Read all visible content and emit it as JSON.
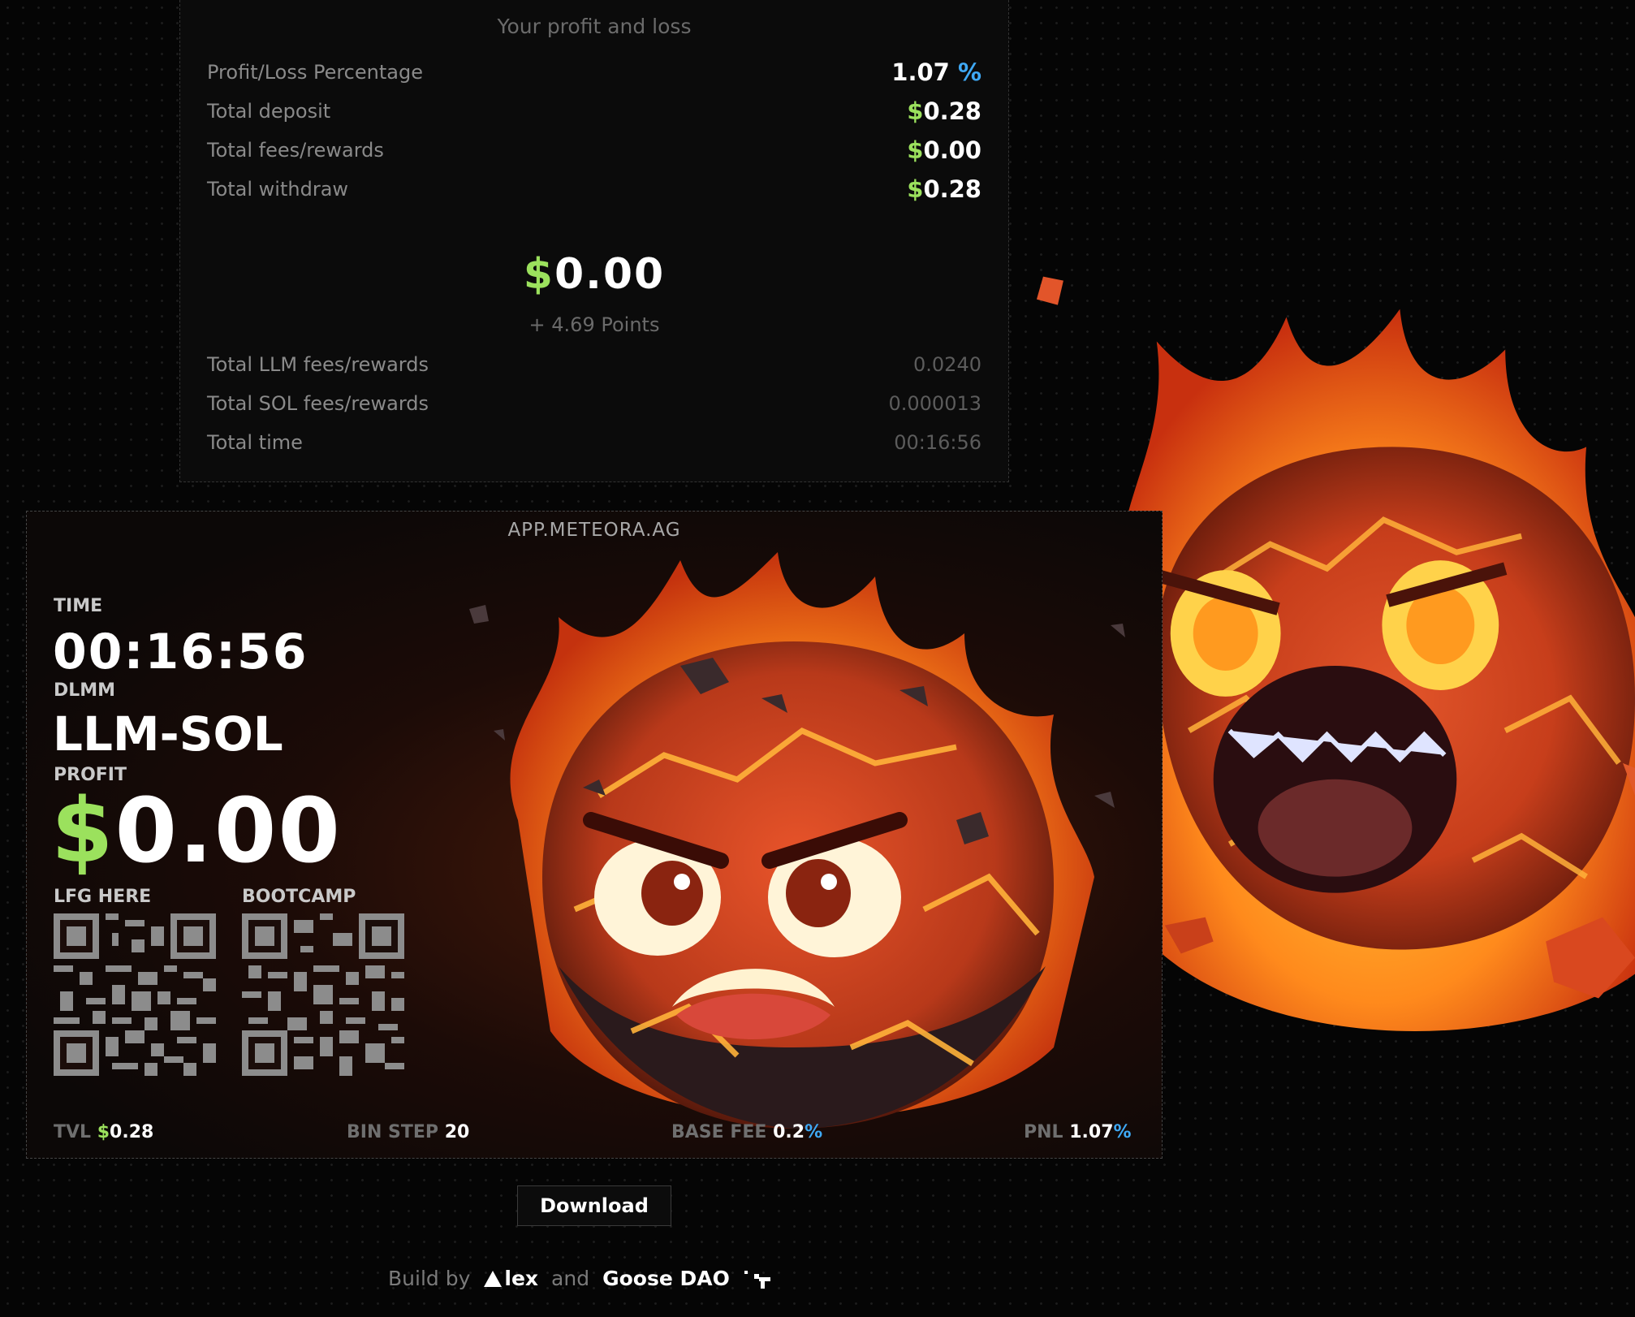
{
  "pnl": {
    "title": "Your profit and loss",
    "rows": [
      {
        "label": "Profit/Loss Percentage",
        "value": "1.07",
        "unit": "%"
      },
      {
        "label": "Total deposit",
        "currency": "$",
        "value": "0.28"
      },
      {
        "label": "Total fees/rewards",
        "currency": "$",
        "value": "0.00"
      },
      {
        "label": "Total withdraw",
        "currency": "$",
        "value": "0.28"
      }
    ],
    "profit_currency": "$",
    "profit_value": "0.00",
    "points": "+ 4.69 Points",
    "detail_rows": [
      {
        "label": "Total LLM fees/rewards",
        "value": "0.0240"
      },
      {
        "label": "Total SOL fees/rewards",
        "value": "0.000013"
      },
      {
        "label": "Total time",
        "value": "00:16:56"
      }
    ]
  },
  "card": {
    "site": "APP.METEORA.AG",
    "time_label": "TIME",
    "time_value": "00:16:56",
    "pool_type": "DLMM",
    "pair": "LLM-SOL",
    "profit_label": "PROFIT",
    "profit_currency": "$",
    "profit_value": "0.00",
    "qr_left_label": "LFG HERE",
    "qr_right_label": "BOOTCAMP",
    "footer": {
      "tvl_label": "TVL",
      "tvl_currency": "$",
      "tvl_value": "0.28",
      "bin_step_label": "BIN STEP",
      "bin_step_value": "20",
      "base_fee_label": "BASE FEE",
      "base_fee_value": "0.2",
      "base_fee_unit": "%",
      "pnl_label": "PNL",
      "pnl_value": "1.07",
      "pnl_unit": "%"
    }
  },
  "download_label": "Download",
  "credits": {
    "prefix": "Build by",
    "alex": "lex",
    "and": "and",
    "goose": "Goose DAO"
  },
  "colors": {
    "dollar_green": "#9be15d",
    "percent_blue": "#3fa9f5",
    "background": "#050505"
  }
}
